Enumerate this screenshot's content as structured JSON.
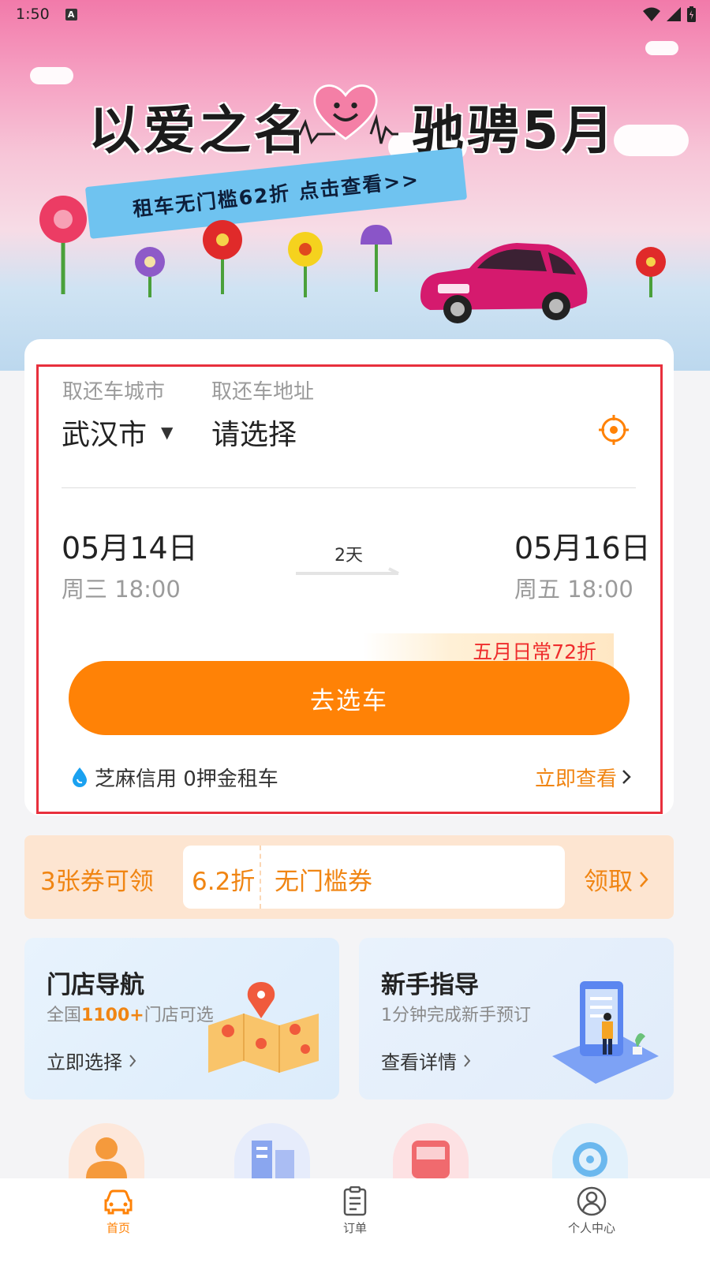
{
  "status_bar": {
    "time": "1:50",
    "a_badge": "A"
  },
  "banner": {
    "title_left": "以爱之名",
    "title_right": "驰骋5月",
    "ribbon_text": "租车无门槛62折  点击查看>>"
  },
  "booking": {
    "city_label": "取还车城市",
    "address_label": "取还车地址",
    "city_value": "武汉市",
    "address_placeholder": "请选择",
    "start_date": "05月14日",
    "start_time": "周三 18:00",
    "end_date": "05月16日",
    "end_time": "周五 18:00",
    "duration": "2天",
    "promo_tag": "五月日常72折",
    "go_button": "去选车",
    "credit_text": "芝麻信用 0押金租车",
    "credit_link": "立即查看"
  },
  "coupon": {
    "count_text": "3张券可领",
    "discount": "6.2折",
    "name": "无门槛券",
    "claim": "领取"
  },
  "features": [
    {
      "title": "门店导航",
      "sub_highlight": "1100+",
      "sub_prefix": "全国",
      "sub_suffix": "门店可选",
      "link": "立即选择"
    },
    {
      "title": "新手指导",
      "sub": "1分钟完成新手预订",
      "link": "查看详情"
    }
  ],
  "bottom_nav": [
    {
      "label": "首页",
      "icon": "car-icon",
      "active": true
    },
    {
      "label": "订单",
      "icon": "order-list-icon",
      "active": false
    },
    {
      "label": "个人中心",
      "icon": "profile-icon",
      "active": false
    }
  ],
  "colors": {
    "accent": "#ff8206",
    "promo_red": "#ef2d2d",
    "link_orange": "#f08513",
    "highlight_border": "#e8303d"
  }
}
